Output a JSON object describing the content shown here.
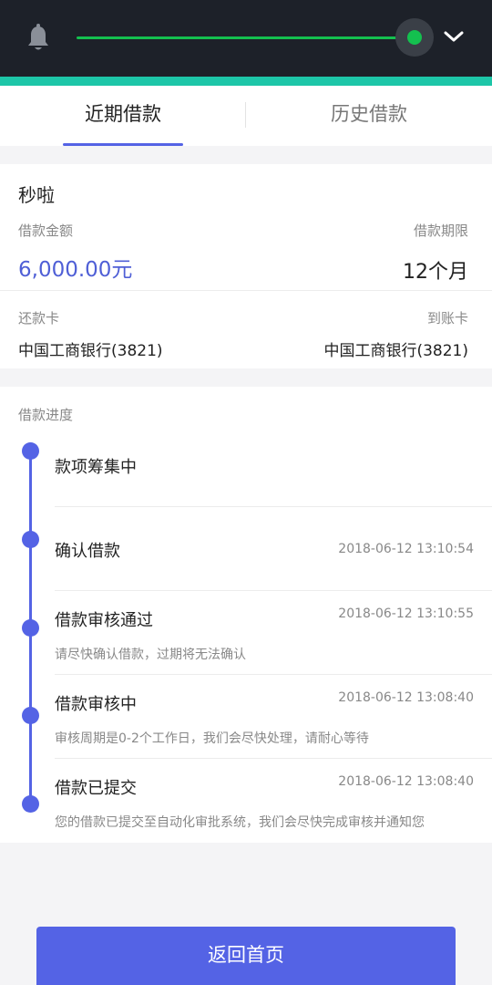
{
  "status_area": {
    "bell_icon": "bell-icon",
    "chevron_icon": "chevron-down-icon",
    "slider_fill": 1.0,
    "colors": {
      "bar": "#1d2129",
      "slider": "#14c04f",
      "accent": "#1dc6a8"
    }
  },
  "tabs": {
    "recent": "近期借款",
    "history": "历史借款"
  },
  "loan": {
    "product": "秒啦",
    "amount_label": "借款金额",
    "amount": "6,000.00元",
    "term_label": "借款期限",
    "term": "12个月",
    "repay_card_label": "还款卡",
    "repay_card": "中国工商银行(3821)",
    "receive_card_label": "到账卡",
    "receive_card": "中国工商银行(3821)"
  },
  "progress": {
    "title": "借款进度",
    "steps": [
      {
        "title": "款项筹集中",
        "time": "",
        "sub": ""
      },
      {
        "title": "确认借款",
        "time": "2018-06-12 13:10:54",
        "sub": ""
      },
      {
        "title": "借款审核通过",
        "time": "2018-06-12 13:10:55",
        "sub": "请尽快确认借款，过期将无法确认"
      },
      {
        "title": "借款审核中",
        "time": "2018-06-12 13:08:40",
        "sub": "审核周期是0-2个工作日，我们会尽快处理，请耐心等待"
      },
      {
        "title": "借款已提交",
        "time": "2018-06-12 13:08:40",
        "sub": "您的借款已提交至自动化审批系统，我们会尽快完成审核并通知您"
      }
    ]
  },
  "footer": {
    "home_button": "返回首页",
    "accent_color": "#5463e5"
  }
}
